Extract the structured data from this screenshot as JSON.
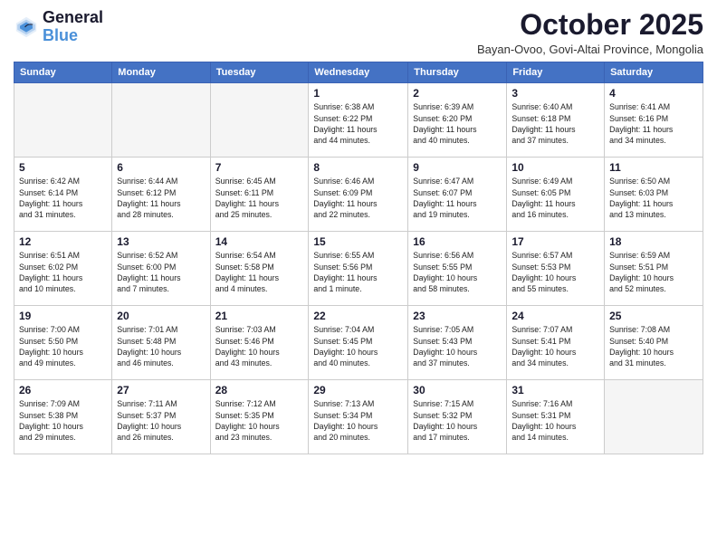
{
  "logo": {
    "text_general": "General",
    "text_blue": "Blue"
  },
  "header": {
    "month": "October 2025",
    "location": "Bayan-Ovoo, Govi-Altai Province, Mongolia"
  },
  "weekdays": [
    "Sunday",
    "Monday",
    "Tuesday",
    "Wednesday",
    "Thursday",
    "Friday",
    "Saturday"
  ],
  "weeks": [
    [
      {
        "day": "",
        "info": ""
      },
      {
        "day": "",
        "info": ""
      },
      {
        "day": "",
        "info": ""
      },
      {
        "day": "1",
        "info": "Sunrise: 6:38 AM\nSunset: 6:22 PM\nDaylight: 11 hours\nand 44 minutes."
      },
      {
        "day": "2",
        "info": "Sunrise: 6:39 AM\nSunset: 6:20 PM\nDaylight: 11 hours\nand 40 minutes."
      },
      {
        "day": "3",
        "info": "Sunrise: 6:40 AM\nSunset: 6:18 PM\nDaylight: 11 hours\nand 37 minutes."
      },
      {
        "day": "4",
        "info": "Sunrise: 6:41 AM\nSunset: 6:16 PM\nDaylight: 11 hours\nand 34 minutes."
      }
    ],
    [
      {
        "day": "5",
        "info": "Sunrise: 6:42 AM\nSunset: 6:14 PM\nDaylight: 11 hours\nand 31 minutes."
      },
      {
        "day": "6",
        "info": "Sunrise: 6:44 AM\nSunset: 6:12 PM\nDaylight: 11 hours\nand 28 minutes."
      },
      {
        "day": "7",
        "info": "Sunrise: 6:45 AM\nSunset: 6:11 PM\nDaylight: 11 hours\nand 25 minutes."
      },
      {
        "day": "8",
        "info": "Sunrise: 6:46 AM\nSunset: 6:09 PM\nDaylight: 11 hours\nand 22 minutes."
      },
      {
        "day": "9",
        "info": "Sunrise: 6:47 AM\nSunset: 6:07 PM\nDaylight: 11 hours\nand 19 minutes."
      },
      {
        "day": "10",
        "info": "Sunrise: 6:49 AM\nSunset: 6:05 PM\nDaylight: 11 hours\nand 16 minutes."
      },
      {
        "day": "11",
        "info": "Sunrise: 6:50 AM\nSunset: 6:03 PM\nDaylight: 11 hours\nand 13 minutes."
      }
    ],
    [
      {
        "day": "12",
        "info": "Sunrise: 6:51 AM\nSunset: 6:02 PM\nDaylight: 11 hours\nand 10 minutes."
      },
      {
        "day": "13",
        "info": "Sunrise: 6:52 AM\nSunset: 6:00 PM\nDaylight: 11 hours\nand 7 minutes."
      },
      {
        "day": "14",
        "info": "Sunrise: 6:54 AM\nSunset: 5:58 PM\nDaylight: 11 hours\nand 4 minutes."
      },
      {
        "day": "15",
        "info": "Sunrise: 6:55 AM\nSunset: 5:56 PM\nDaylight: 11 hours\nand 1 minute."
      },
      {
        "day": "16",
        "info": "Sunrise: 6:56 AM\nSunset: 5:55 PM\nDaylight: 10 hours\nand 58 minutes."
      },
      {
        "day": "17",
        "info": "Sunrise: 6:57 AM\nSunset: 5:53 PM\nDaylight: 10 hours\nand 55 minutes."
      },
      {
        "day": "18",
        "info": "Sunrise: 6:59 AM\nSunset: 5:51 PM\nDaylight: 10 hours\nand 52 minutes."
      }
    ],
    [
      {
        "day": "19",
        "info": "Sunrise: 7:00 AM\nSunset: 5:50 PM\nDaylight: 10 hours\nand 49 minutes."
      },
      {
        "day": "20",
        "info": "Sunrise: 7:01 AM\nSunset: 5:48 PM\nDaylight: 10 hours\nand 46 minutes."
      },
      {
        "day": "21",
        "info": "Sunrise: 7:03 AM\nSunset: 5:46 PM\nDaylight: 10 hours\nand 43 minutes."
      },
      {
        "day": "22",
        "info": "Sunrise: 7:04 AM\nSunset: 5:45 PM\nDaylight: 10 hours\nand 40 minutes."
      },
      {
        "day": "23",
        "info": "Sunrise: 7:05 AM\nSunset: 5:43 PM\nDaylight: 10 hours\nand 37 minutes."
      },
      {
        "day": "24",
        "info": "Sunrise: 7:07 AM\nSunset: 5:41 PM\nDaylight: 10 hours\nand 34 minutes."
      },
      {
        "day": "25",
        "info": "Sunrise: 7:08 AM\nSunset: 5:40 PM\nDaylight: 10 hours\nand 31 minutes."
      }
    ],
    [
      {
        "day": "26",
        "info": "Sunrise: 7:09 AM\nSunset: 5:38 PM\nDaylight: 10 hours\nand 29 minutes."
      },
      {
        "day": "27",
        "info": "Sunrise: 7:11 AM\nSunset: 5:37 PM\nDaylight: 10 hours\nand 26 minutes."
      },
      {
        "day": "28",
        "info": "Sunrise: 7:12 AM\nSunset: 5:35 PM\nDaylight: 10 hours\nand 23 minutes."
      },
      {
        "day": "29",
        "info": "Sunrise: 7:13 AM\nSunset: 5:34 PM\nDaylight: 10 hours\nand 20 minutes."
      },
      {
        "day": "30",
        "info": "Sunrise: 7:15 AM\nSunset: 5:32 PM\nDaylight: 10 hours\nand 17 minutes."
      },
      {
        "day": "31",
        "info": "Sunrise: 7:16 AM\nSunset: 5:31 PM\nDaylight: 10 hours\nand 14 minutes."
      },
      {
        "day": "",
        "info": ""
      }
    ]
  ]
}
